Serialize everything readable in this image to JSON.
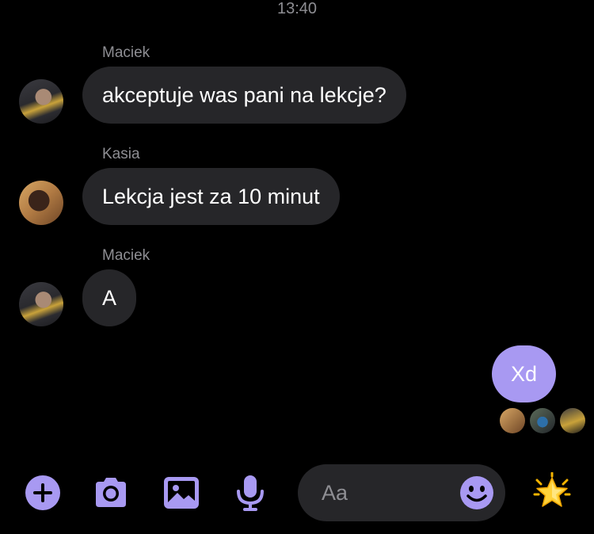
{
  "header": {
    "time": "13:40"
  },
  "messages": [
    {
      "sender": "Maciek",
      "text": "akceptuje was pani na lekcje?"
    },
    {
      "sender": "Kasia",
      "text": "Lekcja jest za 10 minut"
    },
    {
      "sender": "Maciek",
      "text": "A"
    }
  ],
  "outgoing": {
    "text": "Xd"
  },
  "composer": {
    "placeholder": "Aa"
  },
  "icons": {
    "add": "plus-icon",
    "camera": "camera-icon",
    "gallery": "image-icon",
    "voice": "microphone-icon",
    "emoji": "smiley-icon",
    "reaction": "glowing-star-icon"
  },
  "colors": {
    "accent": "#a899f2",
    "bubble": "#262629",
    "meta": "#8e8e93"
  }
}
